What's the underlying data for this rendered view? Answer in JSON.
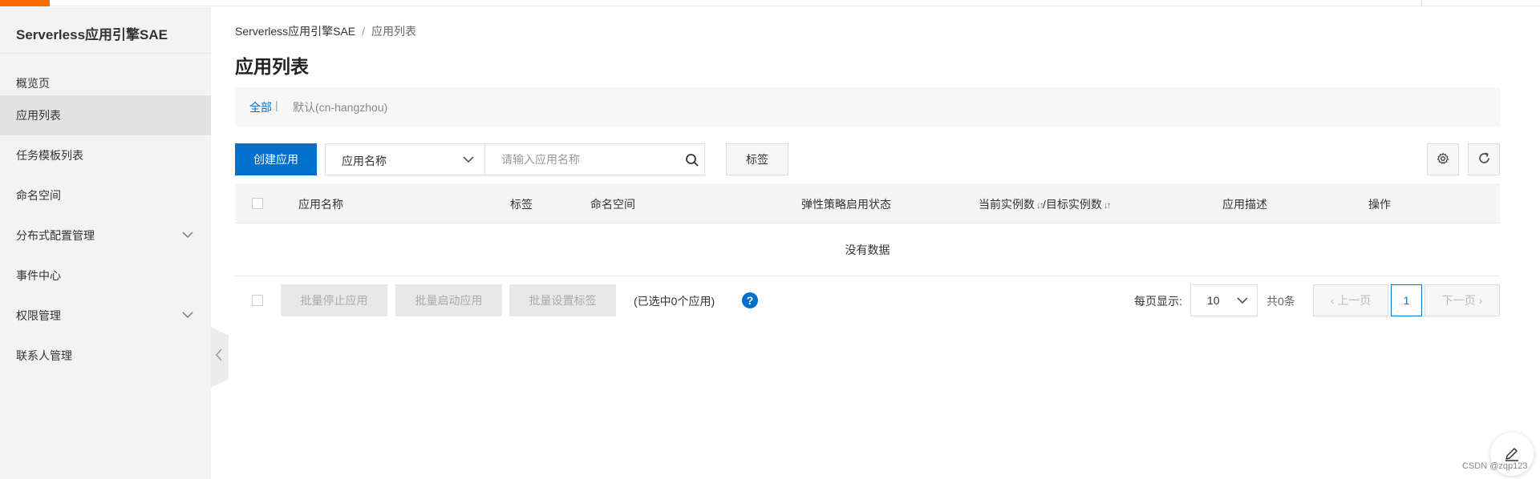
{
  "sidebar": {
    "title": "Serverless应用引擎SAE",
    "items": [
      {
        "label": "概览页"
      },
      {
        "label": "应用列表"
      },
      {
        "label": "任务模板列表"
      },
      {
        "label": "命名空间"
      },
      {
        "label": "分布式配置管理"
      },
      {
        "label": "事件中心"
      },
      {
        "label": "权限管理"
      },
      {
        "label": "联系人管理"
      }
    ],
    "active_item": "应用列表"
  },
  "breadcrumb": {
    "root": "Serverless应用引擎SAE",
    "separator": "/",
    "current": "应用列表"
  },
  "page_title": "应用列表",
  "region_bar": {
    "all": "全部",
    "separator": "|",
    "default_region": "默认(cn-hangzhou)"
  },
  "toolbar": {
    "create_label": "创建应用",
    "search_field": "应用名称",
    "search_placeholder": "请输入应用名称",
    "tag_label": "标签",
    "settings_icon": "gear-icon",
    "refresh_icon": "refresh-icon"
  },
  "table": {
    "columns": [
      "应用名称",
      "标签",
      "命名空间",
      "弹性策略启用状态",
      "当前实例数",
      "/目标实例数",
      "应用描述",
      "操作"
    ],
    "empty_text": "没有数据"
  },
  "footer": {
    "batch_stop": "批量停止应用",
    "batch_start": "批量启动应用",
    "batch_tag": "批量设置标签",
    "selected": "(已选中0个应用)",
    "help": "?",
    "per_page_label": "每页显示:",
    "per_page_value": "10",
    "total": "共0条",
    "prev": "上一页",
    "current_page": "1",
    "next": "下一页"
  },
  "watermark": "CSDN @zqp123",
  "colors": {
    "accent": "#ff6a00",
    "primary": "#0070cc"
  }
}
